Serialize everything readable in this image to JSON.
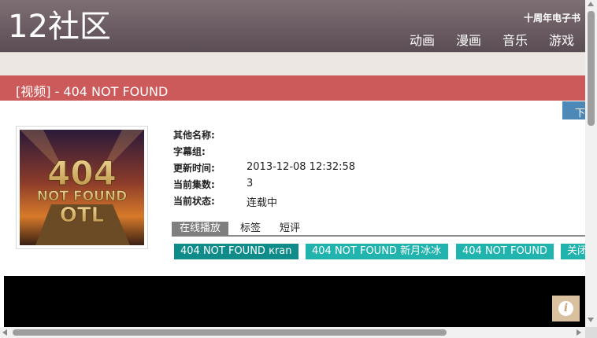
{
  "header": {
    "logo": "12社区",
    "anniversary": "十周年电子书",
    "nav": [
      "动画",
      "漫画",
      "音乐",
      "游戏"
    ]
  },
  "page_title": "[视频] - 404 NOT FOUND",
  "download_button": "下",
  "poster": {
    "line1": "404",
    "line2": "NOT FOUND",
    "line3": "OTL"
  },
  "info": {
    "other_names_label": "其他名称:",
    "other_names": "",
    "subtitle_group_label": "字幕组:",
    "subtitle_group": "",
    "updated_label": "更新时间:",
    "updated": "2013-12-08 12:32:58",
    "episodes_label": "当前集数:",
    "episodes": "3",
    "status_label": "当前状态:",
    "status": "连载中"
  },
  "tabs": [
    "在线播放",
    "标签",
    "短评"
  ],
  "sources": [
    "404 NOT FOUND кran",
    "404 NOT FOUND 新月冰冰",
    "404 NOT FOUND",
    "关闭"
  ],
  "info_button": "i"
}
